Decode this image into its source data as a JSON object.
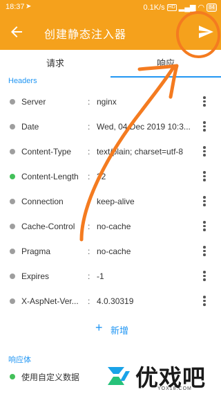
{
  "statusbar": {
    "time": "18:37",
    "speed": "0.1K/s",
    "battery": "84"
  },
  "appbar": {
    "title": "创建静态注入器"
  },
  "tabs": {
    "request": "请求",
    "response": "响应"
  },
  "headers_label": "Headers",
  "headers": [
    {
      "key": "Server",
      "value": "nginx",
      "enabled": false
    },
    {
      "key": "Date",
      "value": "Wed, 04 Dec 2019 10:3...",
      "enabled": false
    },
    {
      "key": "Content-Type",
      "value": "text/plain; charset=utf-8",
      "enabled": false
    },
    {
      "key": "Content-Length",
      "value": "32",
      "enabled": true
    },
    {
      "key": "Connection",
      "value": "keep-alive",
      "enabled": false
    },
    {
      "key": "Cache-Control",
      "value": "no-cache",
      "enabled": false
    },
    {
      "key": "Pragma",
      "value": "no-cache",
      "enabled": false
    },
    {
      "key": "Expires",
      "value": "-1",
      "enabled": false
    },
    {
      "key": "X-AspNet-Ver...",
      "value": "4.0.30319",
      "enabled": false
    }
  ],
  "separator": ":",
  "add_label": "新增",
  "body_label": "响应体",
  "body_option": "使用自定义数据",
  "watermark": {
    "text": "优戏吧",
    "url": "YOX18.COM"
  },
  "colors": {
    "appbar": "#f5a11c",
    "accent": "#2196f3",
    "enabled_dot": "#43c05a",
    "disabled_dot": "#9e9e9e",
    "annotation": "#f47b20"
  }
}
